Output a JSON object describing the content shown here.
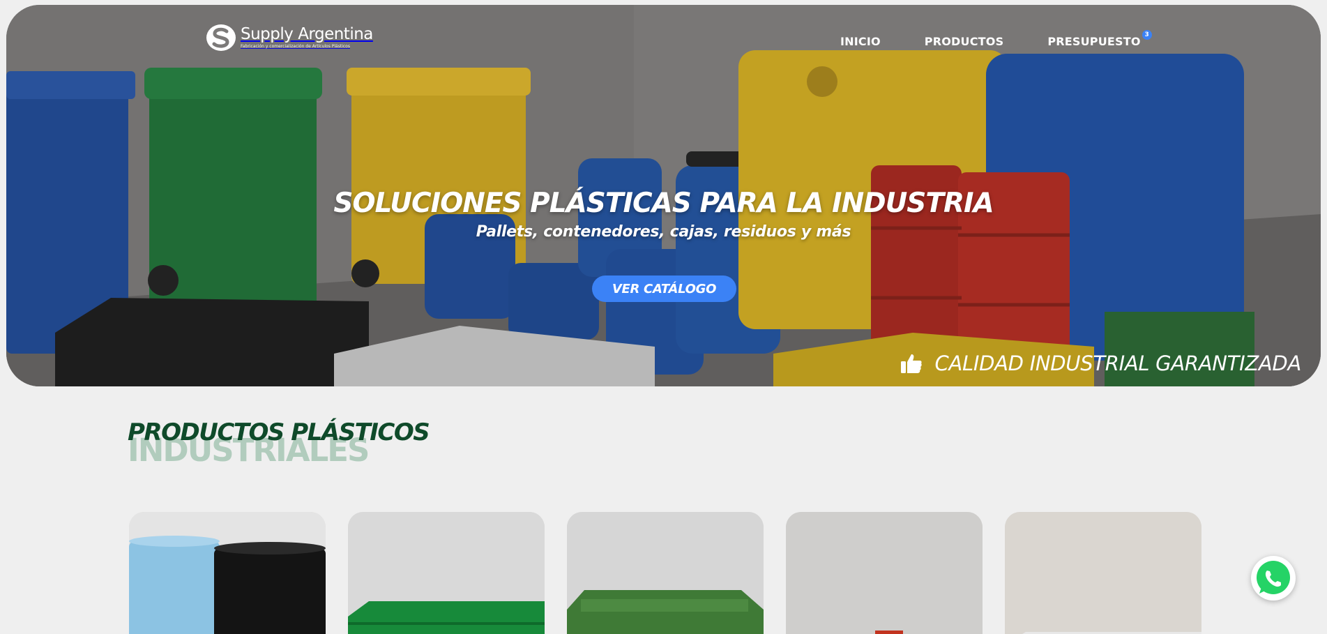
{
  "brand": {
    "name": "Supply Argentina",
    "tagline": "Fabricación y comercialización de Artículos Plásticos"
  },
  "nav": {
    "items": [
      "INICIO",
      "PRODUCTOS",
      "PRESUPUESTO"
    ],
    "cart_count": "3"
  },
  "hero": {
    "title": "SOLUCIONES PLÁSTICAS PARA LA INDUSTRIA",
    "subtitle": "Pallets, contenedores, cajas, residuos y más",
    "cta_label": "VER CATÁLOGO",
    "quality_text": "CALIDAD INDUSTRIAL GARANTIZADA",
    "quality_icon": "thumbs-up-icon"
  },
  "products_section": {
    "title_line1": "PRODUCTOS PLÁSTICOS",
    "title_line2": "INDUSTRIALES",
    "cards": [
      {
        "name": "card-drums"
      },
      {
        "name": "card-pallet"
      },
      {
        "name": "card-container"
      },
      {
        "name": "card-crate"
      },
      {
        "name": "card-tray"
      }
    ]
  },
  "colors": {
    "accent": "#3b82f6",
    "section_dark": "#0f4a2a",
    "section_light": "#b1ccbd",
    "whatsapp": "#25d366"
  },
  "floating": {
    "whatsapp_icon": "whatsapp-icon"
  }
}
